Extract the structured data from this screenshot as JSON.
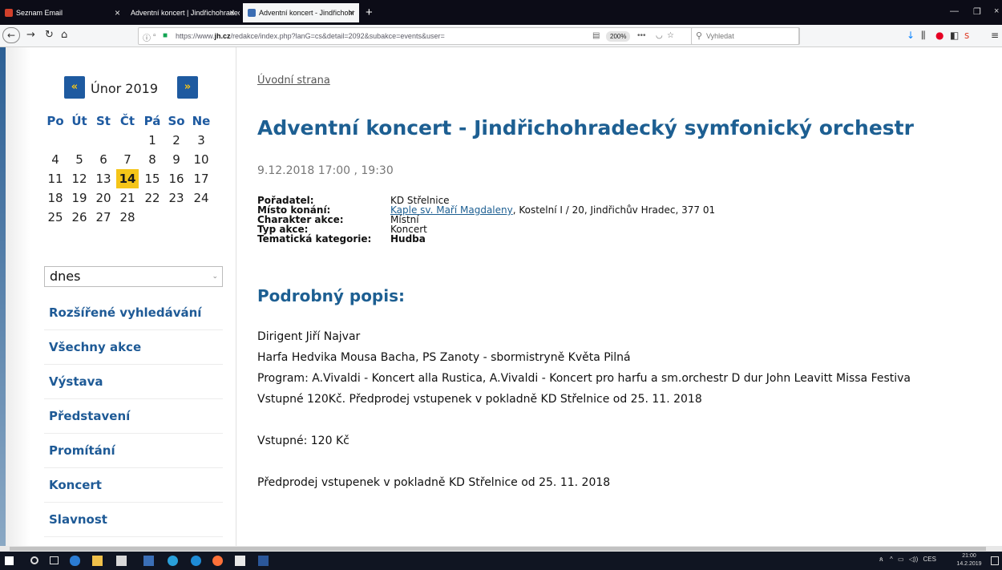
{
  "browser": {
    "tabs": [
      {
        "label": "Seznam Email",
        "active": false
      },
      {
        "label": "Adventní koncert | Jindřichohradec",
        "active": false
      },
      {
        "label": "Adventní koncert - Jindřichohr",
        "active": true
      }
    ],
    "url_prefix": "https://www.",
    "url_domain": "jh.cz",
    "url_rest": "/redakce/index.php?lanG=cs&detail=2092&subakce=events&user=",
    "zoom_level": "200%",
    "search_placeholder": "Vyhledat"
  },
  "calendar": {
    "month_label": "Únor 2019",
    "prev_label": "«",
    "next_label": "»",
    "weekdays": [
      "Po",
      "Út",
      "St",
      "Čt",
      "Pá",
      "So",
      "Ne"
    ],
    "weeks": [
      [
        "",
        "",
        "",
        "",
        "1",
        "2",
        "3"
      ],
      [
        "4",
        "5",
        "6",
        "7",
        "8",
        "9",
        "10"
      ],
      [
        "11",
        "12",
        "13",
        "14",
        "15",
        "16",
        "17"
      ],
      [
        "18",
        "19",
        "20",
        "21",
        "22",
        "23",
        "24"
      ],
      [
        "25",
        "26",
        "27",
        "28",
        "",
        "",
        ""
      ]
    ],
    "today": "14"
  },
  "date_select": {
    "value": "dnes"
  },
  "sidebar_menu": [
    {
      "label": "Rozšířené vyhledávání"
    },
    {
      "label": "Všechny akce"
    },
    {
      "label": "Výstava"
    },
    {
      "label": "Představení"
    },
    {
      "label": "Promítání"
    },
    {
      "label": "Koncert"
    },
    {
      "label": "Slavnost"
    }
  ],
  "content": {
    "breadcrumb": "Úvodní strana",
    "title": "Adventní koncert - Jindřichohradecký symfonický orchestr",
    "date": "9.12.2018 17:00 , 19:30",
    "details": {
      "organizer_label": "Pořadatel:",
      "organizer_value": "KD Střelnice",
      "venue_label": "Místo konání:",
      "venue_link": "Kaple sv. Maří Magdaleny",
      "venue_rest": ", Kostelní I / 20, Jindřichův Hradec, 377 01",
      "character_label": "Charakter akce:",
      "character_value": "Místní",
      "type_label": "Typ akce:",
      "type_value": "Koncert",
      "category_label": "Tematická kategorie:",
      "category_value": "Hudba"
    },
    "desc_heading": "Podrobný popis:",
    "desc_lines": [
      "Dirigent Jiří Najvar",
      "Harfa Hedvika Mousa Bacha, PS Zanoty - sbormistryně Květa Pilná",
      "Program: A.Vivaldi - Koncert alla Rustica, A.Vivaldi - Koncert pro harfu a sm.orchestr D dur John Leavitt Missa Festiva",
      "Vstupné 120Kč. Předprodej vstupenek v pokladně KD Střelnice od 25. 11. 2018"
    ],
    "entry_fee": "Vstupné: 120 Kč",
    "presale": "Předprodej vstupenek v pokladně KD Střelnice od 25. 11. 2018"
  },
  "taskbar": {
    "language": "CES",
    "time": "21:00",
    "date": "14.2.2019"
  },
  "colors": {
    "accent_blue": "#1d5f92",
    "calendar_nav": "#1e5aa0",
    "today_highlight": "#f5c518"
  }
}
